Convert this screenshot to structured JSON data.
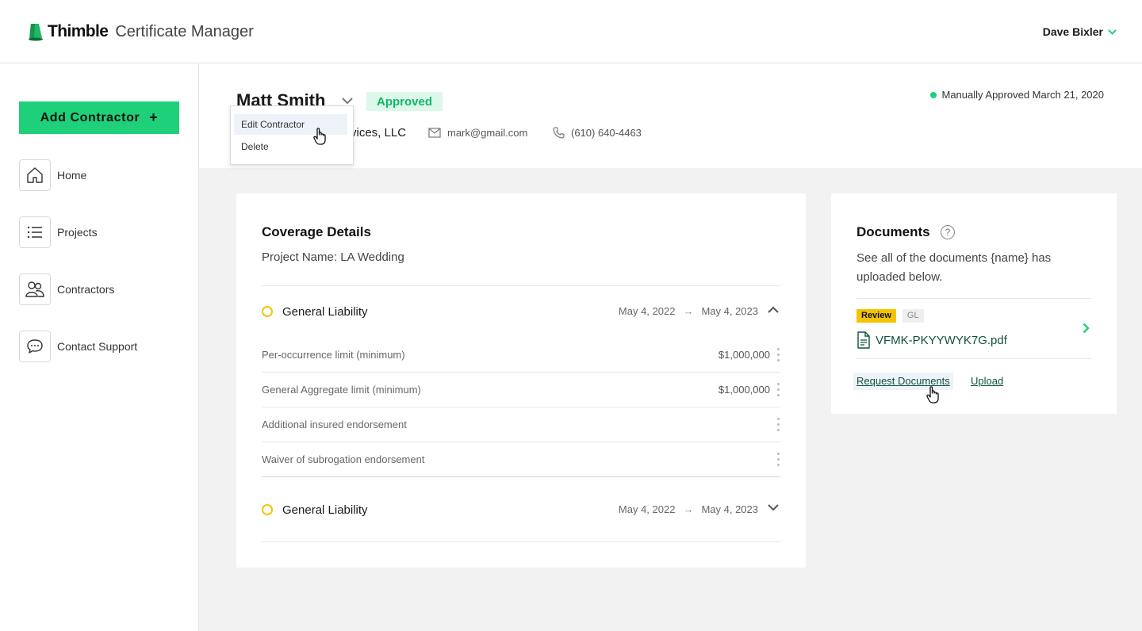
{
  "header": {
    "brand": "Thimble",
    "product": "Certificate Manager",
    "user_name": "Dave Bixler"
  },
  "sidebar": {
    "add_button": "Add Contractor",
    "items": [
      {
        "label": "Home",
        "icon": "home-icon"
      },
      {
        "label": "Projects",
        "icon": "list-icon"
      },
      {
        "label": "Contractors",
        "icon": "users-icon"
      },
      {
        "label": "Contact Support",
        "icon": "chat-icon"
      }
    ]
  },
  "contractor": {
    "name": "Matt Smith",
    "status": "Approved",
    "status_note": "Manually Approved March 21, 2020",
    "company_partial": "vices, LLC",
    "email": "mark@gmail.com",
    "phone": "(610) 640-4463"
  },
  "context_menu": {
    "items": [
      "Edit Contractor",
      "Delete"
    ]
  },
  "coverage": {
    "title": "Coverage Details",
    "project_name": "Project Name: LA Wedding",
    "policies": [
      {
        "title": "General Liability",
        "start": "May 4, 2022",
        "end": "May 4, 2023",
        "expanded": true,
        "limits": [
          {
            "label": "Per-occurrence limit (minimum)",
            "value": "$1,000,000"
          },
          {
            "label": "General Aggregate limit (minimum)",
            "value": "$1,000,000"
          },
          {
            "label": "Additional insured endorsement",
            "value": ""
          },
          {
            "label": "Waiver of subrogation endorsement",
            "value": ""
          }
        ]
      },
      {
        "title": "General Liability",
        "start": "May 4, 2022",
        "end": "May 4, 2023",
        "expanded": false
      }
    ]
  },
  "documents": {
    "title": "Documents",
    "help": "?",
    "description": "See all of the documents {name} has uploaded below.",
    "file": {
      "tag_status": "Review",
      "tag_type": "GL",
      "name": "VFMK-PKYYWYK7G.pdf"
    },
    "request_link": "Request Documents",
    "upload_link": "Upload"
  },
  "colors": {
    "accent_green": "#1fd07a",
    "approved_bg": "#dcf8ea",
    "approved_text": "#12b866",
    "review_yellow": "#f5c400",
    "link_green": "#12523a",
    "ring_yellow": "#f2c600"
  }
}
